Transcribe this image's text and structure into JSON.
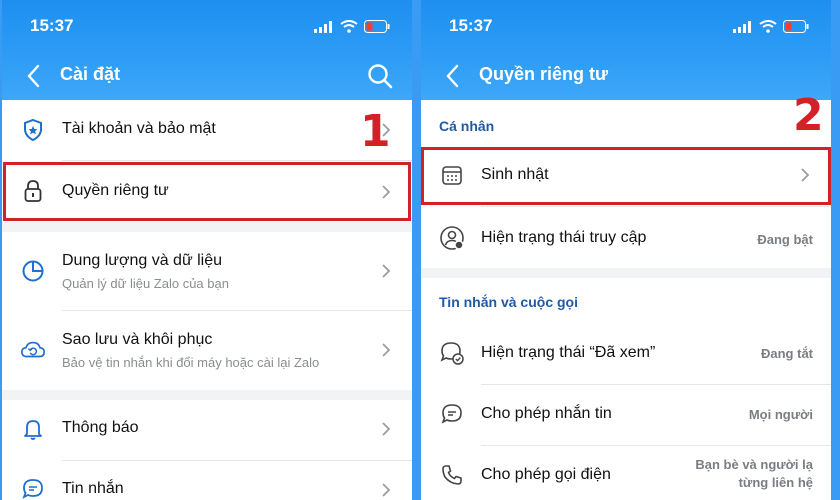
{
  "left": {
    "status_time": "15:37",
    "title": "Cài đặt",
    "items": [
      {
        "label": "Tài khoản và bảo mật",
        "icon": "shield-icon"
      },
      {
        "label": "Quyền riêng tư",
        "icon": "lock-icon"
      },
      {
        "label": "Dung lượng và dữ liệu",
        "sub": "Quản lý dữ liệu Zalo của bạn",
        "icon": "pie-chart-icon"
      },
      {
        "label": "Sao lưu và khôi phục",
        "sub": "Bảo vệ tin nhắn khi đổi máy hoặc cài lại Zalo",
        "icon": "cloud-sync-icon"
      },
      {
        "label": "Thông báo",
        "icon": "bell-icon"
      },
      {
        "label": "Tin nhắn",
        "icon": "chat-icon"
      }
    ],
    "step_number": "1"
  },
  "right": {
    "status_time": "15:37",
    "title": "Quyền riêng tư",
    "step_number": "2",
    "section_personal": "Cá nhân",
    "section_messages": "Tin nhắn và cuộc gọi",
    "items": [
      {
        "label": "Sinh nhật",
        "icon": "calendar-icon"
      },
      {
        "label": "Hiện trạng thái truy cập",
        "value": "Đang bật",
        "icon": "user-status-icon"
      },
      {
        "label": "Hiện trạng thái “Đã xem”",
        "value": "Đang tắt",
        "icon": "seen-chat-icon"
      },
      {
        "label": "Cho phép nhắn tin",
        "value": "Mọi người",
        "icon": "message-icon"
      },
      {
        "label": "Cho phép gọi điện",
        "value": "Bạn bè và người là́",
        "icon": "phone-icon"
      }
    ],
    "call_value_line1": "Bạn bè và người lạ",
    "call_value_line2": "từng liên hệ"
  },
  "colors": {
    "accent": "#1e8ff0",
    "highlight": "#d42027",
    "section_header": "#1e5aa8"
  }
}
